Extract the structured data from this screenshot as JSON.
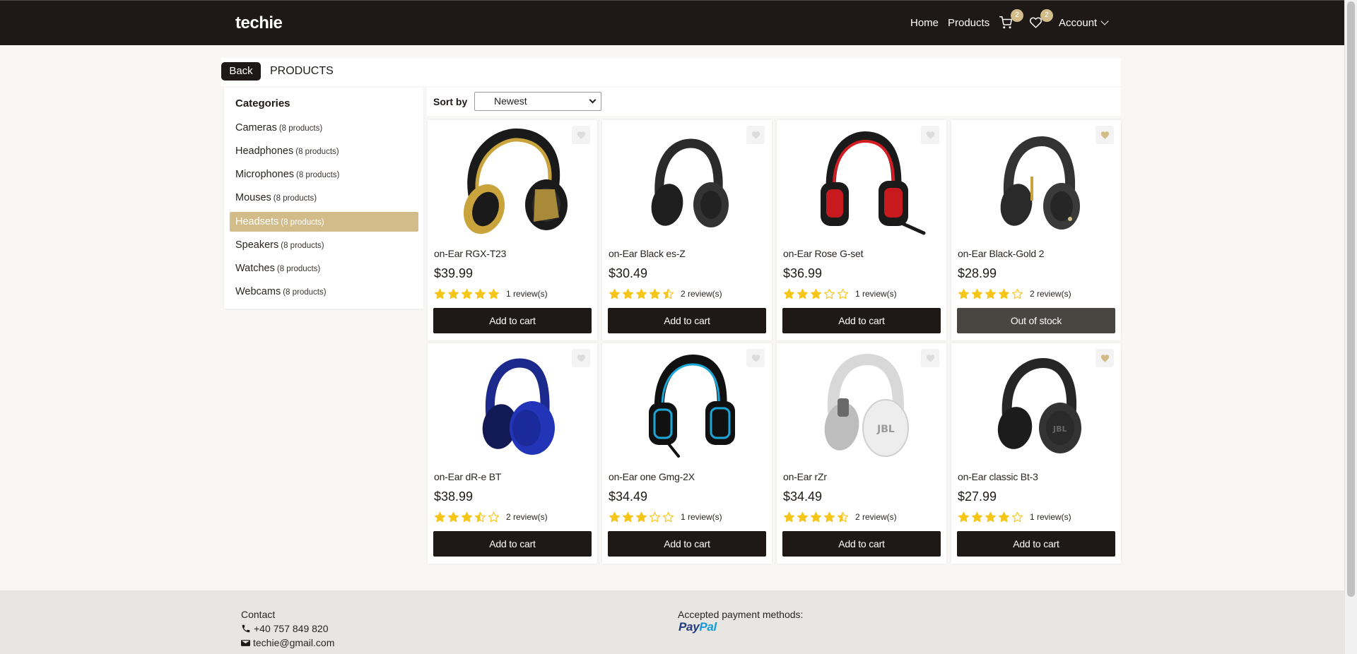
{
  "navbar": {
    "brand": "techie",
    "links": [
      "Home",
      "Products"
    ],
    "cart_count": "2",
    "wishlist_count": "2",
    "account_label": "Account"
  },
  "breadcrumb": {
    "back_label": "Back",
    "title": "PRODUCTS"
  },
  "sidebar": {
    "title": "Categories",
    "items": [
      {
        "label": "Cameras",
        "count": "(8 products)"
      },
      {
        "label": "Headphones",
        "count": "(8 products)"
      },
      {
        "label": "Microphones",
        "count": "(8 products)"
      },
      {
        "label": "Mouses",
        "count": "(8 products)"
      },
      {
        "label": "Headsets",
        "count": "(8 products)"
      },
      {
        "label": "Speakers",
        "count": "(8 products)"
      },
      {
        "label": "Watches",
        "count": "(8 products)"
      },
      {
        "label": "Webcams",
        "count": "(8 products)"
      }
    ],
    "active_index": 4
  },
  "sort": {
    "label": "Sort by",
    "selected": "Newest"
  },
  "products": [
    {
      "name": "on-Ear RGX-T23",
      "price": "$39.99",
      "rating": 5,
      "reviews": "1 review(s)",
      "button": "Add to cart",
      "wishlisted": false,
      "icon": "headphones-gold-icon"
    },
    {
      "name": "on-Ear Black es-Z",
      "price": "$30.49",
      "rating": 4.5,
      "reviews": "2 review(s)",
      "button": "Add to cart",
      "wishlisted": false,
      "icon": "headphones-black-icon"
    },
    {
      "name": "on-Ear Rose G-set",
      "price": "$36.99",
      "rating": 3,
      "reviews": "1 review(s)",
      "button": "Add to cart",
      "wishlisted": false,
      "icon": "gaming-headset-red-icon"
    },
    {
      "name": "on-Ear Black-Gold 2",
      "price": "$28.99",
      "rating": 4,
      "reviews": "2 review(s)",
      "button": "Out of stock",
      "wishlisted": true,
      "icon": "headphones-black-gold-icon"
    },
    {
      "name": "on-Ear dR-e BT",
      "price": "$38.99",
      "rating": 3.5,
      "reviews": "2 review(s)",
      "button": "Add to cart",
      "wishlisted": false,
      "icon": "headphones-blue-icon"
    },
    {
      "name": "on-Ear one Gmg-2X",
      "price": "$34.49",
      "rating": 3,
      "reviews": "1 review(s)",
      "button": "Add to cart",
      "wishlisted": false,
      "icon": "gaming-headset-blue-icon"
    },
    {
      "name": "on-Ear rZr",
      "price": "$34.49",
      "rating": 4.5,
      "reviews": "2 review(s)",
      "button": "Add to cart",
      "wishlisted": false,
      "icon": "headphones-white-icon"
    },
    {
      "name": "on-Ear classic Bt-3",
      "price": "$27.99",
      "rating": 4,
      "reviews": "1 review(s)",
      "button": "Add to cart",
      "wishlisted": true,
      "icon": "headphones-dark-icon"
    }
  ],
  "footer": {
    "contact_title": "Contact",
    "phone": "+40 757 849 820",
    "email": "techie@gmail.com",
    "payment_title": "Accepted payment methods:",
    "paypal_a": "Pay",
    "paypal_b": "Pal"
  },
  "colors": {
    "dark": "#1e1916",
    "accent": "#d2bd8a",
    "star": "#f5c518",
    "oos": "#494541"
  }
}
